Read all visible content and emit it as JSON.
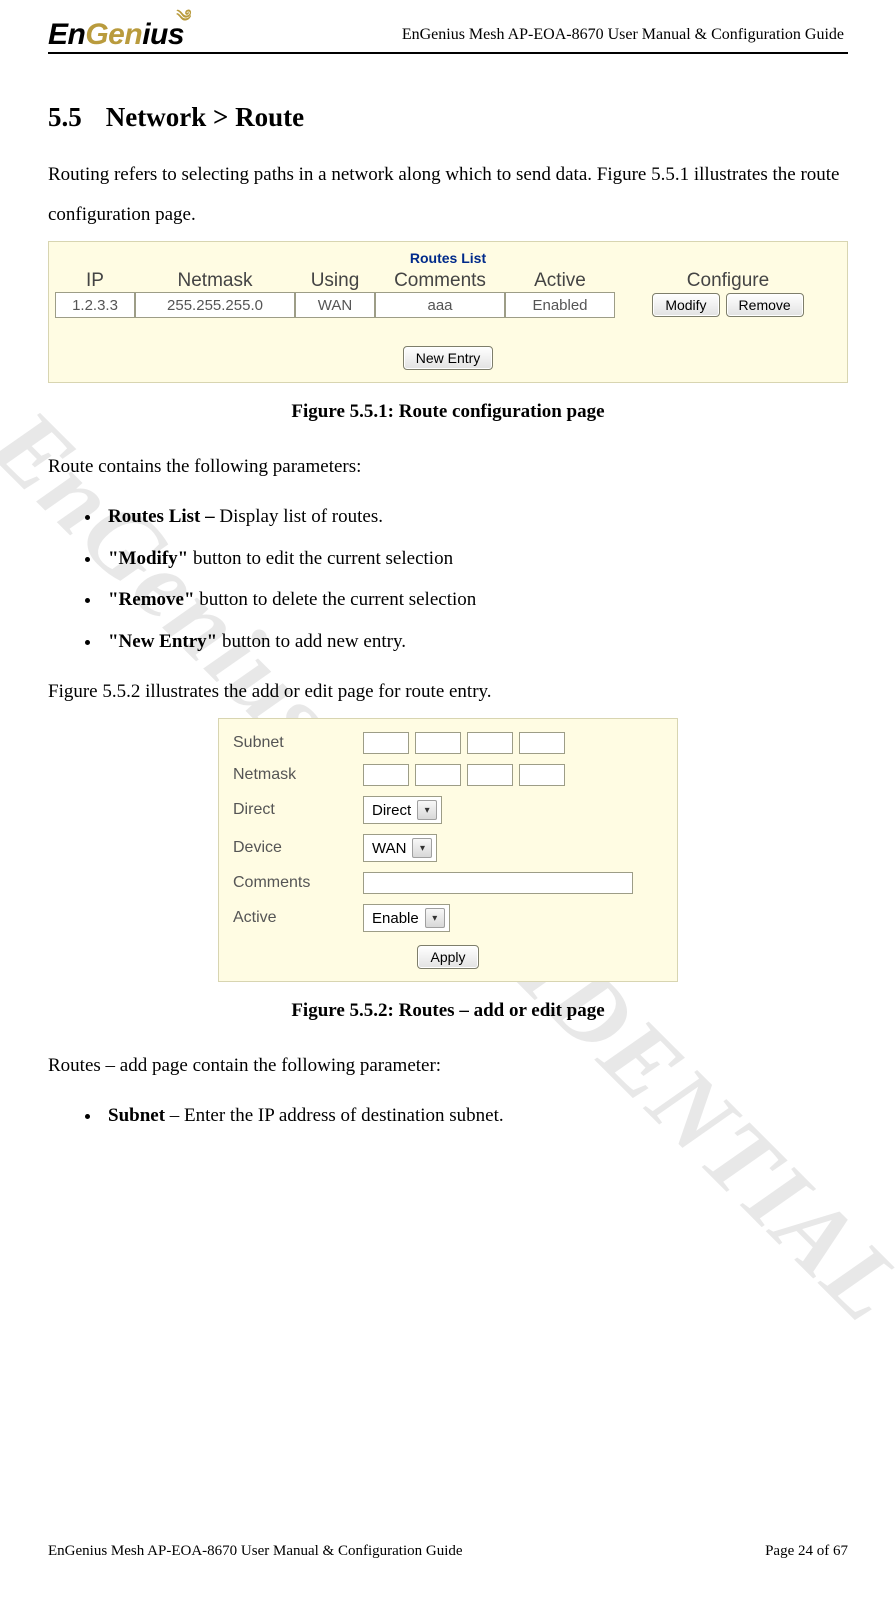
{
  "header": {
    "brand_left": "En",
    "brand_mid": "Gen",
    "brand_right": "ius",
    "title": "EnGenius Mesh AP-EOA-8670 User Manual & Configuration Guide"
  },
  "watermark": "EnGenius CONFIDENTIAL",
  "section": {
    "number": "5.5",
    "title": "Network > Route"
  },
  "intro": "Routing refers to selecting paths in a network along which to send data. Figure 5.5.1 illustrates the route configuration page.",
  "routes_list": {
    "title": "Routes List",
    "headers": {
      "ip": "IP",
      "netmask": "Netmask",
      "using": "Using",
      "comments": "Comments",
      "active": "Active",
      "configure": "Configure"
    },
    "rows": [
      {
        "ip": "1.2.3.3",
        "netmask": "255.255.255.0",
        "using": "WAN",
        "comments": "aaa",
        "active": "Enabled"
      }
    ],
    "modify_btn": "Modify",
    "remove_btn": "Remove",
    "new_entry_btn": "New Entry"
  },
  "caption1": "Figure 5.5.1: Route configuration page",
  "params_intro": "Route contains the following parameters:",
  "params": [
    {
      "bold": "Routes List – ",
      "rest": "Display list of routes."
    },
    {
      "bold": "\"Modify\" ",
      "rest": "button to edit the current selection"
    },
    {
      "bold": "\"Remove\" ",
      "rest": "button to delete the current selection"
    },
    {
      "bold": "\"New Entry\" ",
      "rest": "button to add new entry."
    }
  ],
  "fig2_intro": "Figure 5.5.2 illustrates the add or edit page for route entry.",
  "route_form": {
    "labels": {
      "subnet": "Subnet",
      "netmask": "Netmask",
      "direct": "Direct",
      "device": "Device",
      "comments": "Comments",
      "active": "Active"
    },
    "direct_value": "Direct",
    "device_value": "WAN",
    "active_value": "Enable",
    "apply_btn": "Apply"
  },
  "caption2": "Figure 5.5.2: Routes – add or edit page",
  "addpage_intro": "Routes – add page contain the following parameter:",
  "addpage_bullet": {
    "bold": "Subnet",
    "rest": " – Enter the IP address of destination subnet."
  },
  "footer": {
    "left": "EnGenius Mesh AP-EOA-8670 User Manual & Configuration Guide",
    "right": "Page 24 of 67"
  }
}
